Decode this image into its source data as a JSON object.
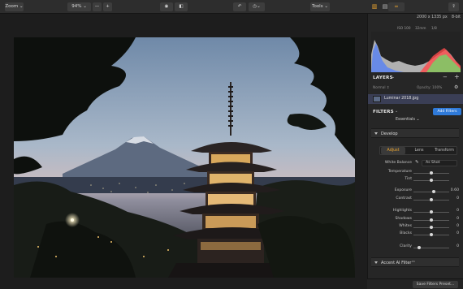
{
  "toolbar": {
    "zoom_label": "Zoom",
    "zoom_value": "94%",
    "tools_label": "Tools"
  },
  "histogram": {
    "dimensions": "2000 x 1335 px",
    "bit_depth": "8-bit",
    "iso": "ISO 100",
    "focal": "32mm",
    "aperture": "1/8"
  },
  "layers": {
    "title": "LAYERS",
    "blend_mode": "Normal",
    "opacity_label": "Opacity: 100%",
    "layer_name": "Luminar 2018.jpg"
  },
  "filters": {
    "title": "FILTERS",
    "add_button": "Add Filters",
    "preset_group": "Essentials"
  },
  "develop": {
    "title": "Develop",
    "tabs": [
      "Adjust",
      "Lens",
      "Transform"
    ],
    "white_balance_label": "White Balance",
    "white_balance_value": "As Shot",
    "sliders": [
      {
        "label": "Temperature",
        "value": "",
        "pos": 0.5
      },
      {
        "label": "Tint",
        "value": "",
        "pos": 0.5
      },
      {
        "label": "Exposure",
        "value": "0.60",
        "pos": 0.56
      },
      {
        "label": "Contrast",
        "value": "0",
        "pos": 0.5
      },
      {
        "label": "Highlights",
        "value": "0",
        "pos": 0.5
      },
      {
        "label": "Shadows",
        "value": "0",
        "pos": 0.5
      },
      {
        "label": "Whites",
        "value": "0",
        "pos": 0.5
      },
      {
        "label": "Blacks",
        "value": "0",
        "pos": 0.5
      },
      {
        "label": "Clarity",
        "value": "0",
        "pos": 0.15
      }
    ]
  },
  "accent": {
    "title": "Accent AI Filter™"
  },
  "footer": {
    "save_preset": "Save Filters Preset..."
  },
  "colors": {
    "accent_orange": "#f0a830",
    "accent_blue": "#2f7ad9"
  }
}
